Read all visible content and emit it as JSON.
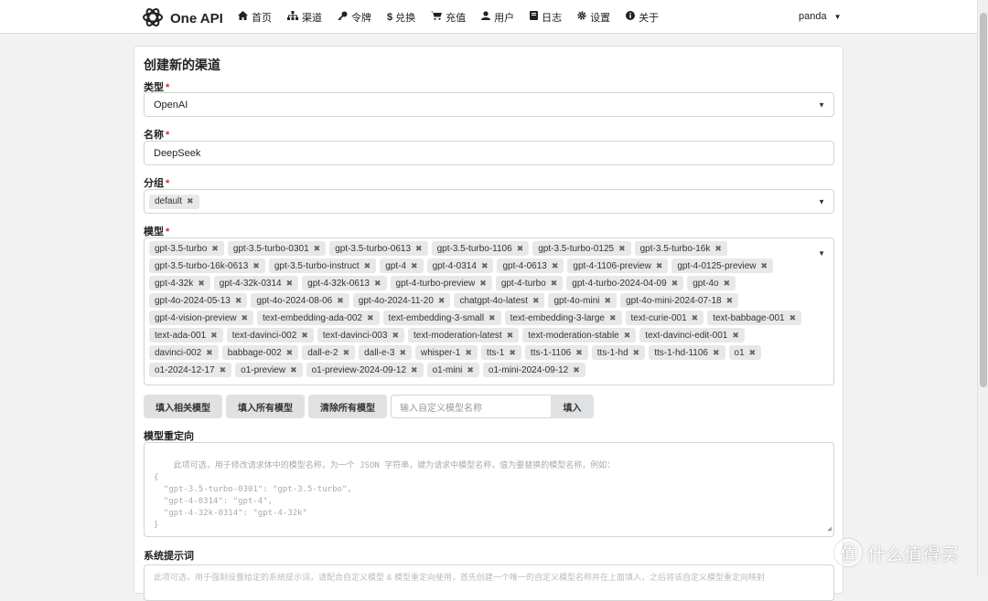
{
  "app": {
    "name": "One API"
  },
  "nav": [
    {
      "label": "首页",
      "icon": "home-icon"
    },
    {
      "label": "渠道",
      "icon": "sitemap-icon"
    },
    {
      "label": "令牌",
      "icon": "key-icon"
    },
    {
      "label": "兑换",
      "icon": "dollar-icon"
    },
    {
      "label": "充值",
      "icon": "cart-icon"
    },
    {
      "label": "用户",
      "icon": "user-icon"
    },
    {
      "label": "日志",
      "icon": "book-icon"
    },
    {
      "label": "设置",
      "icon": "gear-icon"
    },
    {
      "label": "关于",
      "icon": "info-icon"
    }
  ],
  "user": {
    "name": "panda"
  },
  "form": {
    "title": "创建新的渠道",
    "type": {
      "label": "类型",
      "value": "OpenAI"
    },
    "name": {
      "label": "名称",
      "value": "DeepSeek"
    },
    "group": {
      "label": "分组",
      "tags": [
        "default"
      ]
    },
    "models": {
      "label": "模型",
      "tags": [
        "gpt-3.5-turbo",
        "gpt-3.5-turbo-0301",
        "gpt-3.5-turbo-0613",
        "gpt-3.5-turbo-1106",
        "gpt-3.5-turbo-0125",
        "gpt-3.5-turbo-16k",
        "gpt-3.5-turbo-16k-0613",
        "gpt-3.5-turbo-instruct",
        "gpt-4",
        "gpt-4-0314",
        "gpt-4-0613",
        "gpt-4-1106-preview",
        "gpt-4-0125-preview",
        "gpt-4-32k",
        "gpt-4-32k-0314",
        "gpt-4-32k-0613",
        "gpt-4-turbo-preview",
        "gpt-4-turbo",
        "gpt-4-turbo-2024-04-09",
        "gpt-4o",
        "gpt-4o-2024-05-13",
        "gpt-4o-2024-08-06",
        "gpt-4o-2024-11-20",
        "chatgpt-4o-latest",
        "gpt-4o-mini",
        "gpt-4o-mini-2024-07-18",
        "gpt-4-vision-preview",
        "text-embedding-ada-002",
        "text-embedding-3-small",
        "text-embedding-3-large",
        "text-curie-001",
        "text-babbage-001",
        "text-ada-001",
        "text-davinci-002",
        "text-davinci-003",
        "text-moderation-latest",
        "text-moderation-stable",
        "text-davinci-edit-001",
        "davinci-002",
        "babbage-002",
        "dall-e-2",
        "dall-e-3",
        "whisper-1",
        "tts-1",
        "tts-1-1106",
        "tts-1-hd",
        "tts-1-hd-1106",
        "o1",
        "o1-2024-12-17",
        "o1-preview",
        "o1-preview-2024-09-12",
        "o1-mini",
        "o1-mini-2024-09-12"
      ]
    },
    "buttons": {
      "fill_related": "填入相关模型",
      "fill_all": "填入所有模型",
      "clear_all": "清除所有模型",
      "custom_placeholder": "输入自定义模型名称",
      "fill": "填入"
    },
    "redirect": {
      "label": "模型重定向",
      "placeholder": "此项可选，用于修改请求体中的模型名称，为一个 JSON 字符串，键为请求中模型名称，值为要替换的模型名称，例如：\n{\n  \"gpt-3.5-turbo-0301\": \"gpt-3.5-turbo\",\n  \"gpt-4-0314\": \"gpt-4\",\n  \"gpt-4-32k-0314\": \"gpt-4-32k\"\n}"
    },
    "system_prompt": {
      "label": "系统提示词",
      "placeholder": "此项可选，用于强制设置给定的系统提示词，请配合自定义模型 & 模型重定向使用，首先创建一个唯一的自定义模型名称并在上面填入，之后将该自定义模型重定向映射"
    }
  },
  "watermark": {
    "icon_text": "值",
    "text": "什么值得买"
  }
}
